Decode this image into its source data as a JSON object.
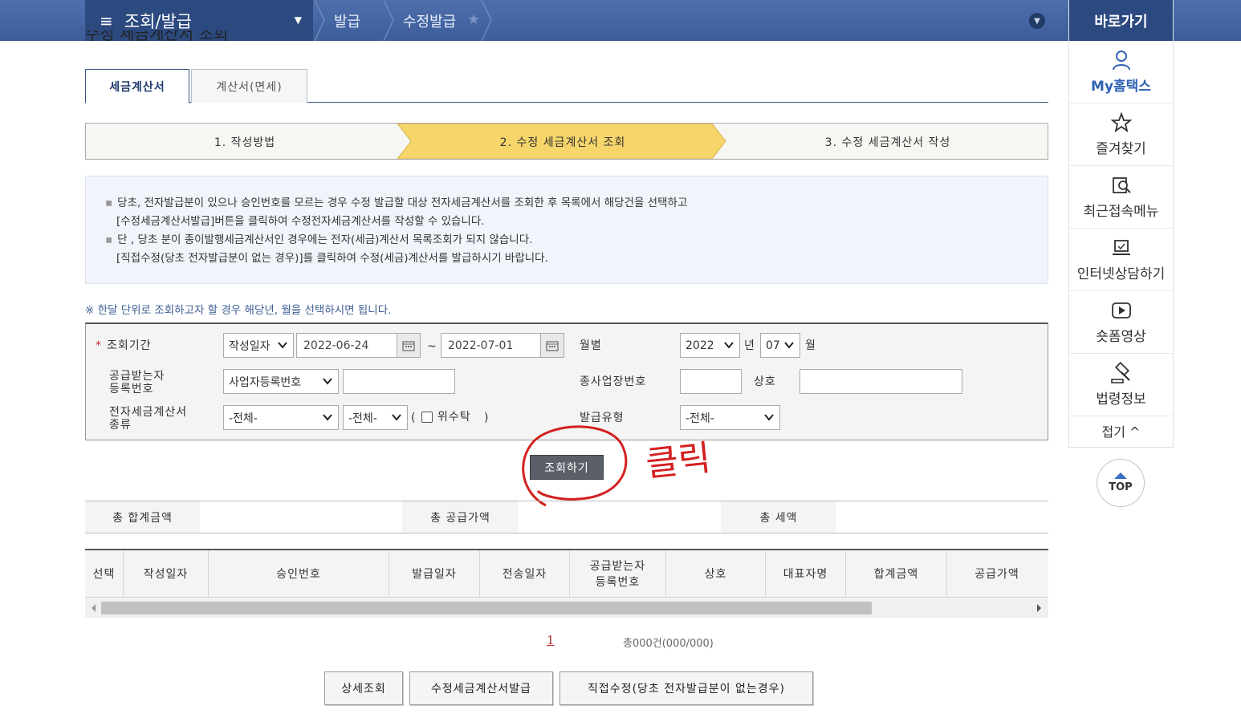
{
  "nav": {
    "menu_title": "조회/발급",
    "crumbs": [
      "발급",
      "수정발급"
    ],
    "quick_title": "바로가기"
  },
  "quick": {
    "items": [
      "My홈택스",
      "즐겨찾기",
      "최근접속메뉴",
      "인터넷상담하기",
      "숏폼영상",
      "법령정보"
    ],
    "fold": "접기 ^",
    "top": "TOP"
  },
  "page": {
    "title": "수정 세금계산서 조회"
  },
  "tabs": [
    "세금계산서",
    "계산서(면세)"
  ],
  "steps": [
    "1. 작성방법",
    "2. 수정 세금계산서 조회",
    "3. 수정 세금계산서 작성"
  ],
  "info": {
    "lines": [
      "당초, 전자발급분이 있으나 승인번호를 모르는 경우 수정 발급할 대상 전자세금계산서를 조회한 후 목록에서 해당건을 선택하고",
      "[수정세금계산서발급]버튼을 클릭하여 수정전자세금계산서를 작성할 수 있습니다.",
      "단 , 당초 분이 종이발행세금계산서인 경우에는 전자(세금)계산서 목록조회가 되지 않습니다.",
      "[직접수정(당초 전자발급분이 없는 경우)]를 클릭하여 수정(세금)계산서를 발급하시기 바랍니다."
    ]
  },
  "note": "※ 한달 단위로 조회하고자 할 경우 해당년, 월을 선택하시면 됩니다.",
  "form": {
    "period_label": "조회기간",
    "date_type": "작성일자",
    "date_from": "2022-06-24",
    "tilde": "~",
    "date_to": "2022-07-01",
    "monthly_label": "월별",
    "year": "2022",
    "year_unit": "년",
    "month": "07",
    "month_unit": "월",
    "recipient_label_1": "공급받는자",
    "recipient_label_2": "등록번호",
    "recipient_type": "사업자등록번호",
    "recipient_value": "",
    "branch_label": "종사업장번호",
    "branch_value": "",
    "company_label": "상호",
    "company_value": "",
    "kind_label_1": "전자세금계산서",
    "kind_label_2": "종류",
    "kind_1": "-전체-",
    "kind_2": "-전체-",
    "paren_open": "(",
    "consign_label": "위수탁",
    "paren_close": ")",
    "issue_type_label": "발급유형",
    "issue_type": "-전체-"
  },
  "search_button": "조회하기",
  "annotation": "클릭",
  "totals": [
    "총 합계금액",
    "총 공급가액",
    "총 세액"
  ],
  "table": {
    "columns": [
      "선택",
      "작성일자",
      "승인번호",
      "발급일자",
      "전송일자",
      "공급받는자\n등록번호",
      "상호",
      "대표자명",
      "합계금액",
      "공급가액"
    ]
  },
  "pager": {
    "page": "1",
    "count": "총000건(000/000)"
  },
  "buttons": [
    "상세조회",
    "수정세금계산서발급",
    "직접수정(당초 전자발급분이 없는경우)"
  ],
  "colors": {
    "nav": "#3c5d9a",
    "step_active": "#f6d56b",
    "accent_red": "#d42020"
  }
}
